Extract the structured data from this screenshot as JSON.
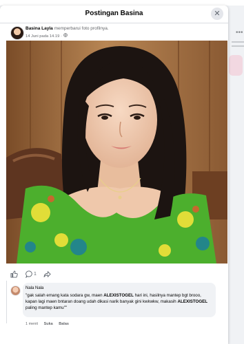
{
  "modal": {
    "title": "Postingan Basina",
    "close_icon": "close-icon"
  },
  "post": {
    "author": "Basina Layla",
    "action": "memperbarui foto profilnya.",
    "timestamp": "14 Juni pada 14.19",
    "privacy_icon": "globe-icon"
  },
  "actions": {
    "like_icon": "thumbs-up-icon",
    "comment_icon": "comment-icon",
    "comment_count": "1",
    "share_icon": "share-icon"
  },
  "comment": {
    "author": "Nala Nala",
    "text_part1": "\"gak salah emang kata sodara gw, maen ",
    "brand1": "ALEXISTOGEL",
    "text_part2": " hari ini, hasilnya mantep bgt brooo, kapan lagi maen bntaran doang udah dikasi narik banyak gini kwkwkw, makasih ",
    "brand2": "ALEXISTOGEL",
    "text_part3": " paling mantep kamu\"\"",
    "age": "1 menit",
    "like_label": "Suka",
    "reply_label": "Balas"
  },
  "colors": {
    "surface": "#ffffff",
    "bubble": "#f0f2f5",
    "muted_text": "#65676b",
    "dress_green": "#4caf2d",
    "hair": "#1c1411",
    "wall": "#9a6a3e"
  }
}
